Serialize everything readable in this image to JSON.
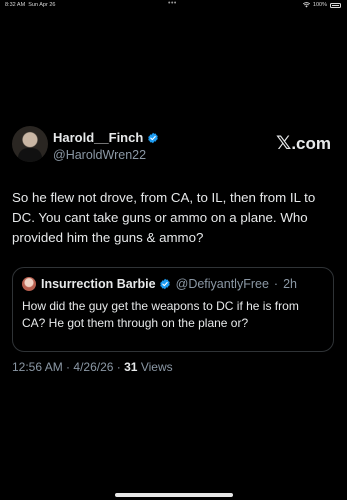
{
  "status_bar": {
    "time": "8:32 AM",
    "date": "Sun Apr 26",
    "dots": "•••",
    "wifi_icon": "wifi-icon",
    "battery": "100%",
    "battery_icon": "battery-icon"
  },
  "tweet": {
    "author": {
      "display_name": "Harold__Finch",
      "handle": "@HaroldWren22",
      "verified": true
    },
    "brand_logo": "𝕏",
    "brand_text": ".com",
    "text": "So he flew not drove, from CA, to IL, then from IL to DC. You cant take guns or ammo on a plane. Who provided him the guns & ammo?",
    "quote": {
      "display_name": "Insurrection Barbie",
      "handle": "@DefiyantlyFree",
      "separator": "·",
      "age": "2h",
      "verified": true,
      "text": "How did the guy get the weapons to DC if he is from CA? He got them through on the plane or?"
    },
    "meta": {
      "time": "12:56 AM",
      "date": "4/26/26",
      "separator": "·",
      "views_count": "31",
      "views_label": "Views"
    }
  },
  "colors": {
    "background": "#000000",
    "text": "#e7e9ea",
    "secondary": "#8b98a5",
    "verified_blue": "#1d9bf0",
    "border": "#2f3336"
  }
}
